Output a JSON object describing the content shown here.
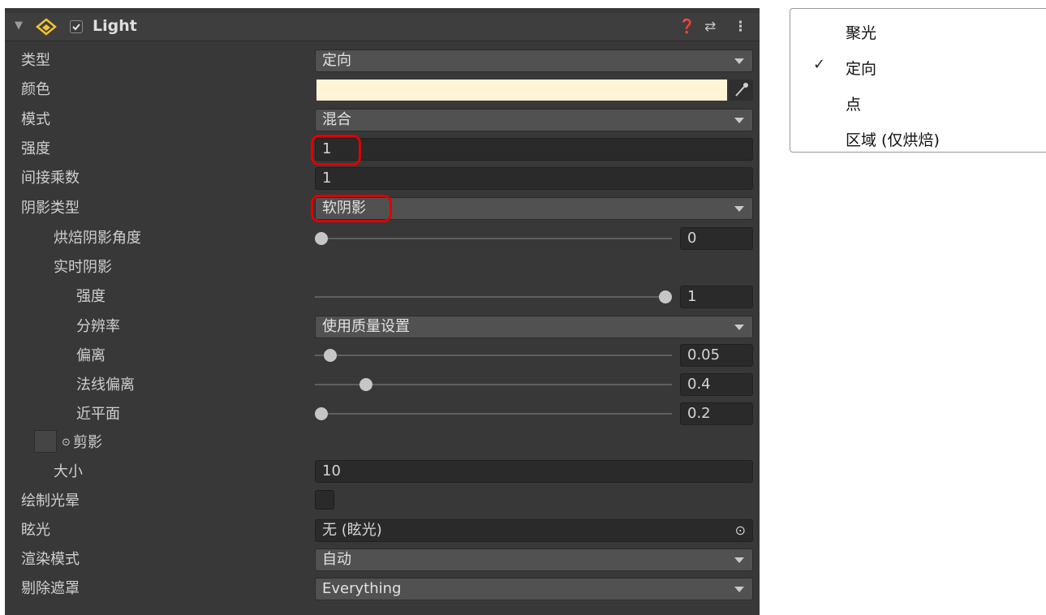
{
  "component": {
    "title": "Light",
    "enabled": true
  },
  "rows": {
    "type": {
      "label": "类型",
      "value": "定向"
    },
    "color": {
      "label": "颜色",
      "swatch": "#FFF4D6"
    },
    "mode": {
      "label": "模式",
      "value": "混合"
    },
    "intensity": {
      "label": "强度",
      "value": "1"
    },
    "indirect": {
      "label": "间接乘数",
      "value": "1"
    },
    "shadow_type": {
      "label": "阴影类型",
      "value": "软阴影"
    },
    "baked_angle": {
      "label": "烘焙阴影角度",
      "value": "0",
      "fraction": 0.0
    },
    "realtime": {
      "label": "实时阴影"
    },
    "rt_strength": {
      "label": "强度",
      "value": "1",
      "fraction": 1.0
    },
    "resolution": {
      "label": "分辨率",
      "value": "使用质量设置"
    },
    "bias": {
      "label": "偏离",
      "value": "0.05",
      "fraction": 0.025
    },
    "normal_bias": {
      "label": "法线偏离",
      "value": "0.4",
      "fraction": 0.13
    },
    "near_plane": {
      "label": "近平面",
      "value": "0.2",
      "fraction": 0.0
    },
    "cookie": {
      "label": "剪影",
      "prefix": "⊙"
    },
    "size": {
      "label": "大小",
      "value": "10"
    },
    "draw_halo": {
      "label": "绘制光晕",
      "checked": false
    },
    "flare": {
      "label": "眩光",
      "value": "无 (眩光)"
    },
    "render_mode": {
      "label": "渲染模式",
      "value": "自动"
    },
    "culling": {
      "label": "剔除遮罩",
      "value": "Everything"
    }
  },
  "menu": {
    "items": [
      {
        "label": "聚光",
        "checked": false
      },
      {
        "label": "定向",
        "checked": true
      },
      {
        "label": "点",
        "checked": false
      },
      {
        "label": "区域 (仅烘焙)",
        "checked": false
      }
    ],
    "check_glyph": "✓"
  },
  "colors": {
    "highlight": "#E00000",
    "light_icon": "#F2C230"
  }
}
